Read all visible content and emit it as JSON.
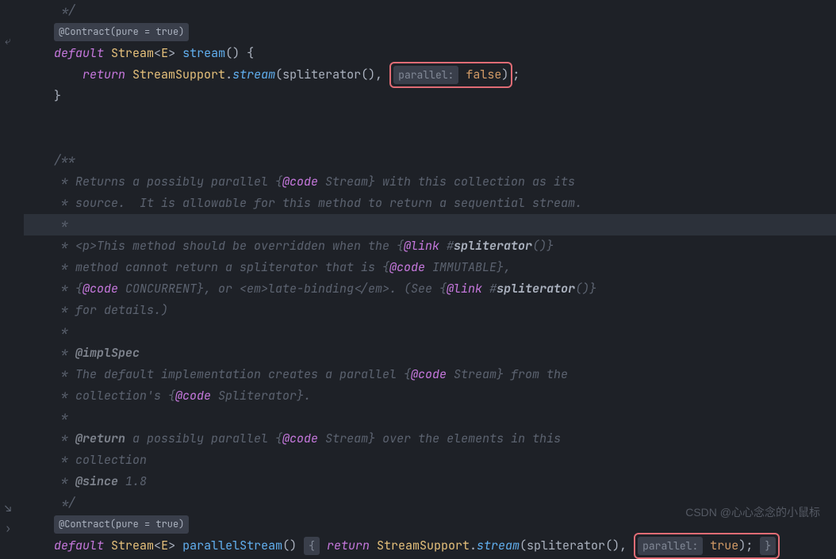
{
  "annotations": {
    "contract": "@Contract(pure = true)"
  },
  "hints": {
    "parallel": "parallel:"
  },
  "code": {
    "closeComment": " */",
    "kw_default": "default",
    "type_stream": "Stream",
    "type_e": "E",
    "method_stream": "stream",
    "method_parallelStream": "parallelStream",
    "kw_return": "return",
    "type_streamSupport": "StreamSupport",
    "method_stream_call": "stream",
    "method_spliterator": "spliterator",
    "lit_false": "false",
    "lit_true": "true"
  },
  "doc": {
    "open": "/**",
    "l1a": " * Returns a possibly parallel {",
    "l1b": "@code",
    "l1c": " Stream} with this collection as its",
    "l2": " * source.  It is allowable for this method to return a sequential stream.",
    "star": " *",
    "l4a": " * <p>This method should be overridden when the {",
    "l4b": "@link",
    "l4c": " #",
    "l4d": "spliterator",
    "l4e": "()}",
    "l5a": " * method cannot return a spliterator that is {",
    "l5b": "@code",
    "l5c": " IMMUTABLE},",
    "l6a": " * {",
    "l6b": "@code",
    "l6c": " CONCURRENT}, or <em>late-binding</em>. (See {",
    "l6d": "@link",
    "l6e": " #",
    "l6f": "spliterator",
    "l6g": "()}",
    "l7": " * for details.)",
    "implSpec": "@implSpec",
    "l9a": " * The default implementation creates a parallel {",
    "l9b": "@code",
    "l9c": " Stream} from the",
    "l10a": " * collection's {",
    "l10b": "@code",
    "l10c": " Spliterator}.",
    "l12a": "@return",
    "l12b": " a possibly parallel {",
    "l12c": "@code",
    "l12d": " Stream} over the elements in this",
    "l13": " * collection",
    "l14a": "@since",
    "l14b": " 1.8",
    "close": " */"
  },
  "watermark": "CSDN @心心念念的小鼠标"
}
